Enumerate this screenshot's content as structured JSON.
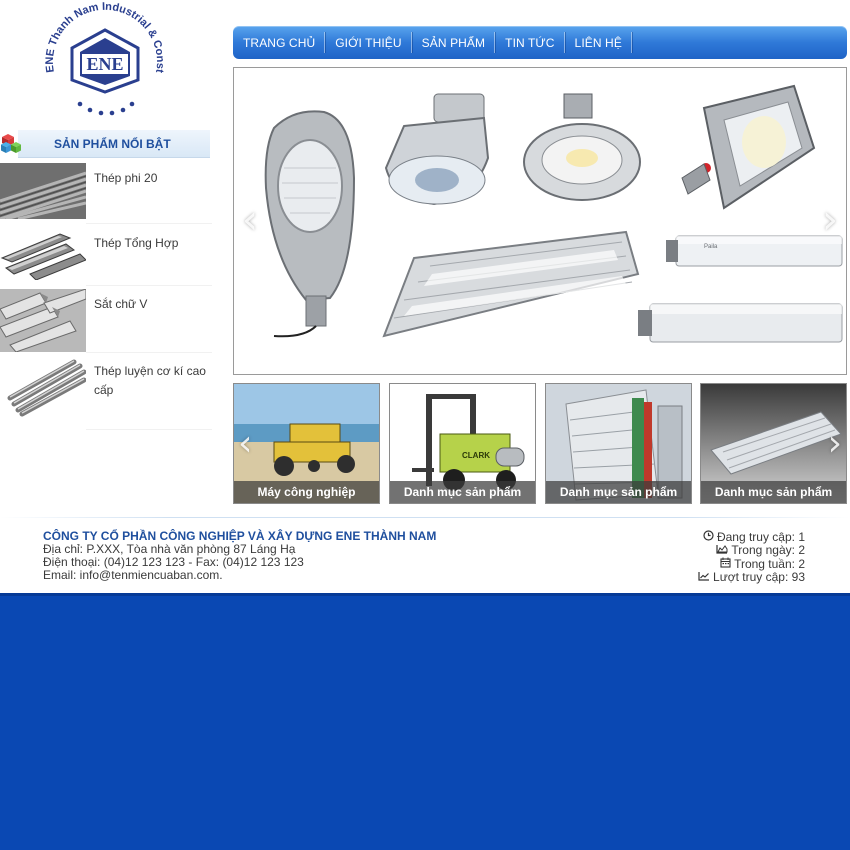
{
  "logo": {
    "arc_text": "ENE Thanh Nam Industrial & Construction JSC",
    "monogram": "ENE"
  },
  "sidebar": {
    "title": "SẢN PHẨM NỔI BẬT",
    "products": [
      {
        "name": "Thép phi 20"
      },
      {
        "name": "Thép Tổng Hợp"
      },
      {
        "name": "Sắt chữ V"
      },
      {
        "name": "Thép luyện cơ kí cao cấp"
      }
    ]
  },
  "nav": {
    "items": [
      "TRANG CHỦ",
      "GIỚI THIỆU",
      "SẢN PHẨM",
      "TIN TỨC",
      "LIÊN HỆ"
    ]
  },
  "slider": {
    "prev_icon": "chevron-left-icon",
    "next_icon": "chevron-right-icon",
    "tube_brand": "Paila"
  },
  "categories": [
    {
      "label": "Máy công nghiệp"
    },
    {
      "label": "Danh mục sản phẩm"
    },
    {
      "label": "Danh mục sản phẩm"
    },
    {
      "label": "Danh mục sản phẩm"
    }
  ],
  "footer": {
    "company_name": "CÔNG TY CỔ PHẦN CÔNG NGHIỆP VÀ XÂY DỰNG ENE THÀNH NAM",
    "address": "Địa chỉ: P.XXX, Tòa nhà văn phòng 87 Láng Hạ",
    "phone": "Điện thoại: (04)12 123 123 - Fax: (04)12 123 123",
    "email": "Email: info@tenmiencuaban.com.",
    "stats": [
      {
        "icon": "clock-icon",
        "text": "Đang truy cập: 1"
      },
      {
        "icon": "area-chart-icon",
        "text": "Trong ngày: 2"
      },
      {
        "icon": "calendar-icon",
        "text": "Trong tuần: 2"
      },
      {
        "icon": "line-chart-icon",
        "text": "Lượt truy cập: 93"
      }
    ]
  },
  "colors": {
    "nav_blue": "#2f79d8",
    "title_blue": "#1f4f9e",
    "footer_blue": "#0a48b3"
  }
}
